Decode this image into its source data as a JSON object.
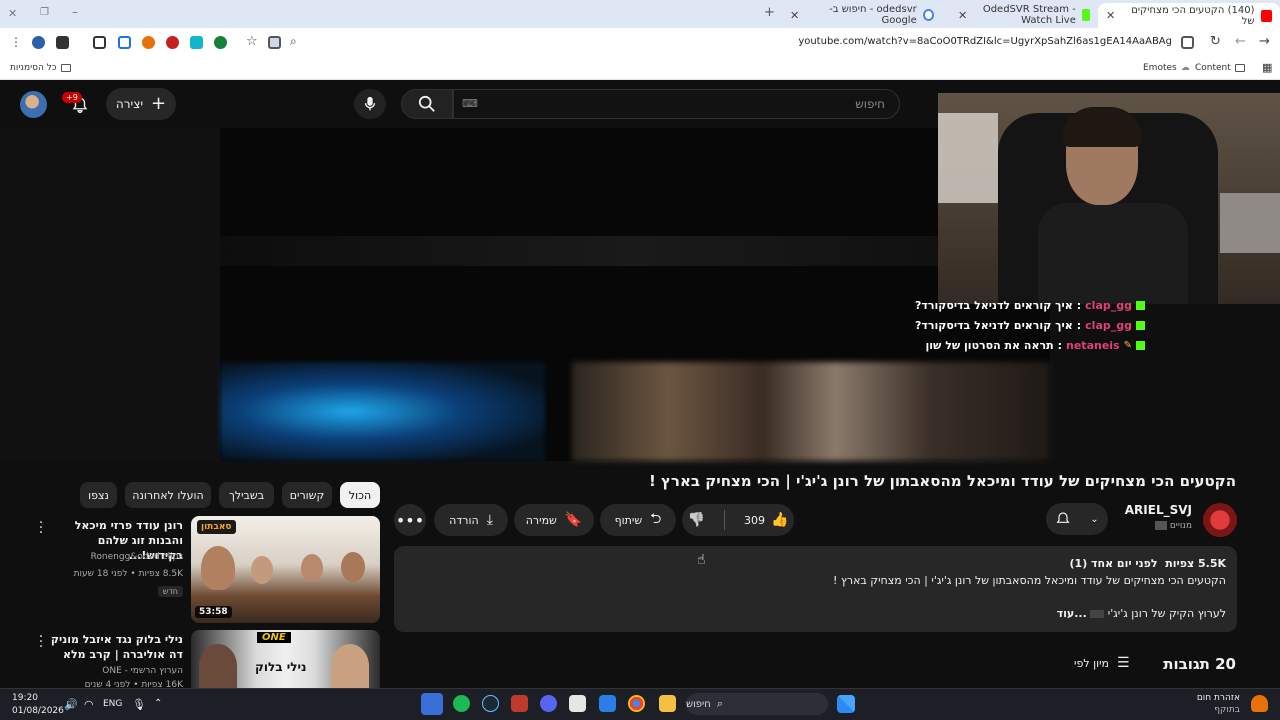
{
  "browser": {
    "tabs": [
      {
        "label": "(140) הקטעים הכי מצחיקים של",
        "active": true
      },
      {
        "label": "OdedSVR Stream - Watch Live",
        "active": false
      },
      {
        "label": "odedsvr - חיפוש ב-Google",
        "active": false
      }
    ],
    "url": "youtube.com/watch?v=8aCoO0TRdZI&lc=UgyrXpSahZl6as1gEA14AaABAg",
    "bookmarks": {
      "all_bookmarks": "כל הסימניות",
      "emotes": "Emotes",
      "content": "Content"
    }
  },
  "youtube": {
    "search_placeholder": "חיפוש",
    "create_label": "יצירה",
    "notification_badge": "+9"
  },
  "chat": [
    {
      "user": "clap_gg",
      "msg": "איך קוראים לדניאל בדיסקורד?"
    },
    {
      "user": "clap_gg",
      "msg": "איך קוראים לדניאל בדיסקורד?"
    },
    {
      "user": "netaneis",
      "msg": "תראה את הסרטון של שון"
    }
  ],
  "video": {
    "title": "הקטעים הכי מצחיקים של עודד ומיכאל מהסאבתון של רונן ג'יג'י | הכי מצחיק בארץ !",
    "channel": "ARIEL_SVJ",
    "subscribers": "מנויים",
    "likes": "309",
    "share_label": "שיתוף",
    "save_label": "שמירה",
    "download_label": "הורדה",
    "views": "5.5K צפיות",
    "posted": "לפני יום אחד (1)",
    "description_line1": "הקטעים הכי מצחיקים של עודד ומיכאל מהסאבתון של רונן ג'יג'י | הכי מצחיק בארץ !",
    "description_line2": "לערוץ הקיק של רונן ג'יג'י",
    "more_label": "...עוד",
    "comments_count": "20 תגובות",
    "sort_label": "מיון לפי"
  },
  "chips": [
    "הכול",
    "קשורים",
    "בשבילך",
    "הועלו לאחרונה",
    "נצפו"
  ],
  "recommendations": [
    {
      "title": "רונן עודד פרזי מיכאל והבנות זוג שלהם בקידוש!...",
      "channel": "Ronengg&oded clips",
      "meta": "8.5K צפיות • לפני 18 שעות",
      "badge": "חדש",
      "duration": "53:58",
      "thumb_text": "סאבתון"
    },
    {
      "title": "נילי בלוק נגד איזבל מוניק דה אוליברה | קרב מלא",
      "channel": "הערוץ הרשמי - ONE",
      "meta": "16K צפיות • לפני 4 שנים",
      "thumb_text": "ONE",
      "thumb_name": "נילי בלוק"
    }
  ],
  "taskbar": {
    "time": "19:20",
    "date": "01/08/2026",
    "lang": "ENG",
    "search": "חיפוש",
    "alert_title": "אזהרת חום",
    "alert_sub": "בתוקף"
  },
  "colors": {
    "accent": "#cc0000",
    "kick_green": "#53fc18",
    "chat_user": "#e0407a"
  }
}
